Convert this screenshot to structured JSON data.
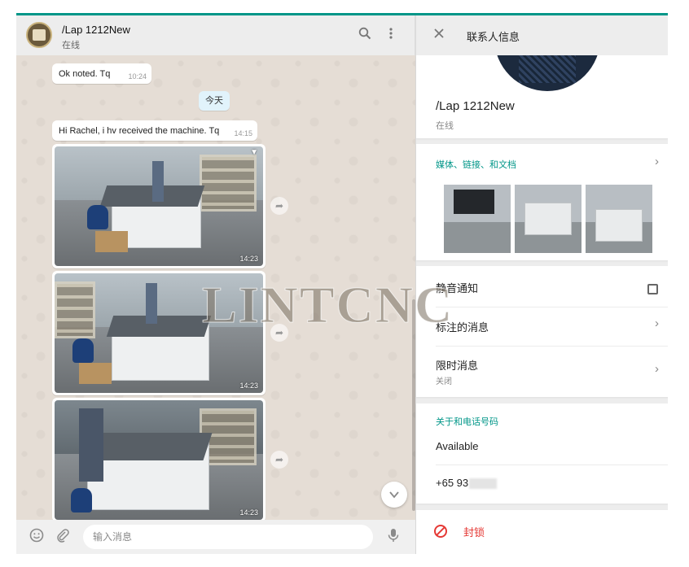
{
  "chat": {
    "contact_name": "/Lap 1212New",
    "contact_status": "在线",
    "header_icons": [
      "search-icon",
      "more-vertical-icon"
    ],
    "messages": [
      {
        "type": "text",
        "text": "Ok noted. Tq",
        "time": "10:24"
      },
      {
        "type": "date",
        "text": "今天"
      },
      {
        "type": "text",
        "text": "Hi Rachel, i hv received the machine. Tq",
        "time": "14:15"
      },
      {
        "type": "image",
        "time": "14:23"
      },
      {
        "type": "image",
        "time": "14:23"
      },
      {
        "type": "image",
        "time": "14:23"
      }
    ],
    "composer_placeholder": "输入消息",
    "composer_icons": [
      "emoji-icon",
      "paperclip-icon",
      "microphone-icon"
    ]
  },
  "info": {
    "title": "联系人信息",
    "name": "/Lap 1212New",
    "status": "在线",
    "media_label": "媒体、链接、和文档",
    "mute_label": "静音通知",
    "mute_checked": false,
    "starred_label": "标注的消息",
    "disappearing_label": "限时消息",
    "disappearing_value": "关闭",
    "about_label": "关于和电话号码",
    "about_value": "Available",
    "phone": "+65 93",
    "block_label": "封锁"
  },
  "watermark": "LINTCNC"
}
